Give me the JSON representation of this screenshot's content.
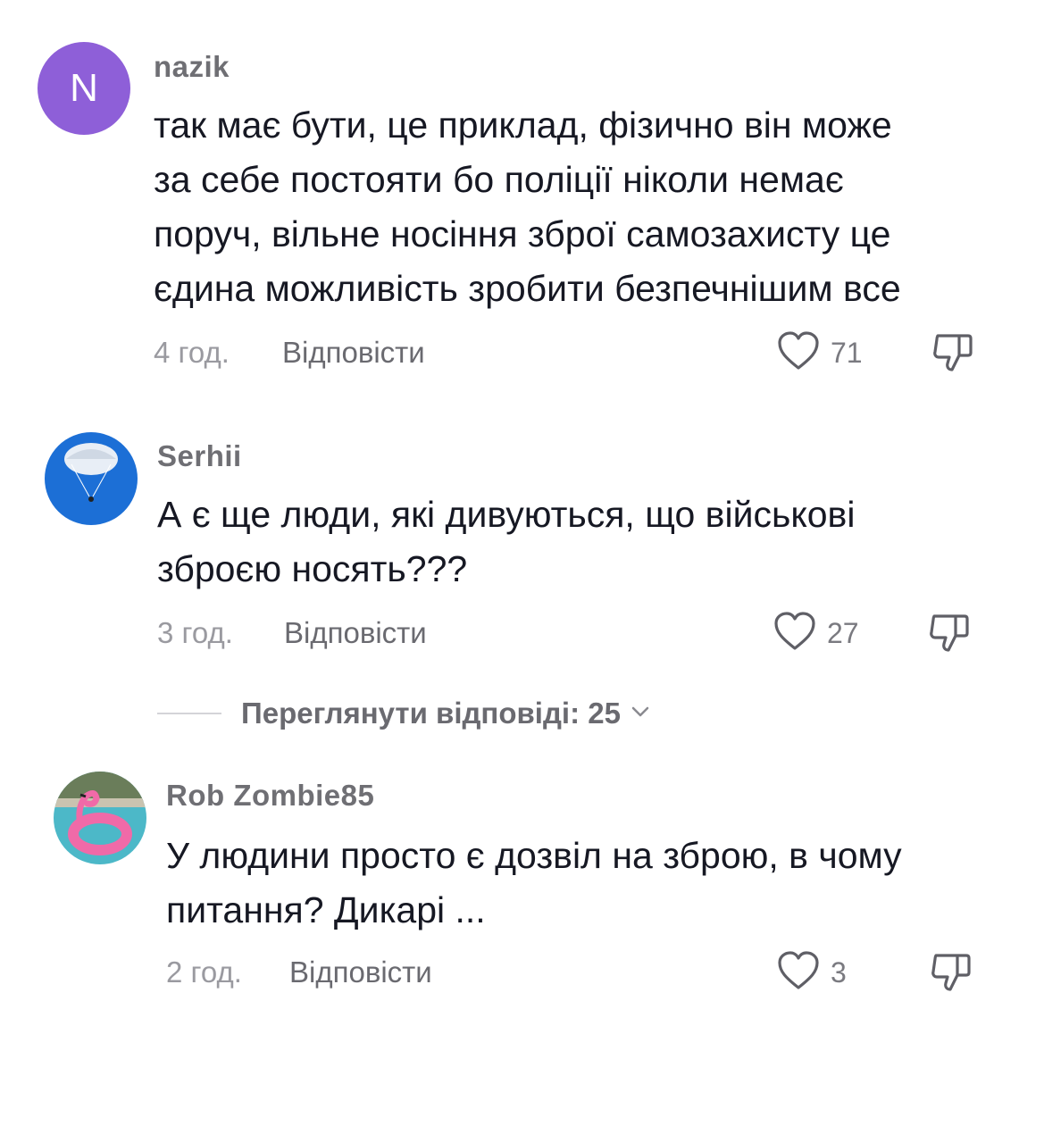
{
  "comments": [
    {
      "avatar_letter": "N",
      "username": "nazik",
      "text": "так має бути, це приклад, фізично він може\nза себе постояти бо поліції ніколи немає\nпоруч, вільне носіння зброї самозахисту це\nєдина можливість зробити безпечнішим все",
      "time": "4 год.",
      "reply_label": "Відповісти",
      "likes": "71"
    },
    {
      "username": "Serhii",
      "text": "А є ще люди, які дивуються, що військові\nзброєю носять???",
      "time": "3 год.",
      "reply_label": "Відповісти",
      "likes": "27"
    },
    {
      "username": "Rob Zombie85",
      "text": "У людини просто є дозвіл на зброю, в чому\nпитання? Дикарі ...",
      "time": "2 год.",
      "reply_label": "Відповісти",
      "likes": "3"
    }
  ],
  "view_replies": {
    "label": "Переглянути відповіді: 25"
  },
  "colors": {
    "avatar_n": "#8e5fd8",
    "text": "#161823",
    "muted": "#9a9aa0",
    "icon": "#6a6a70"
  },
  "icons": [
    "heart-icon",
    "thumbs-down-icon",
    "chevron-down-icon"
  ]
}
